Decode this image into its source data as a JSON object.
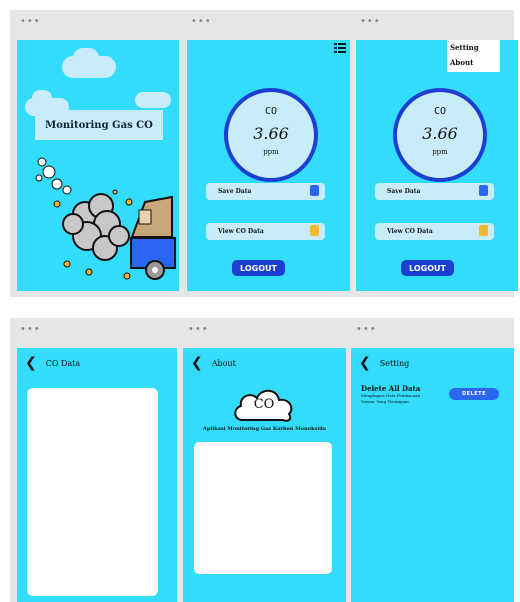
{
  "screens": {
    "splash": {
      "title": "Monitoring Gas CO"
    },
    "home": {
      "gas_label": "CO",
      "reading": "3.66",
      "unit": "ppm",
      "save_label": "Save Data",
      "view_label": "View CO Data",
      "logout_label": "LOGOUT"
    },
    "home_menu": {
      "gas_label": "CO",
      "reading": "3.66",
      "unit": "ppm",
      "save_label": "Save Data",
      "view_label": "View CO Data",
      "logout_label": "LOGOUT",
      "menu_items": [
        "Setting",
        "About"
      ]
    },
    "co_data": {
      "title": "CO Data"
    },
    "about": {
      "title": "About",
      "logo_text": "CO",
      "app_name": "Aplikasi Monitoring Gas Karbon Monoksida"
    },
    "setting": {
      "title": "Setting",
      "delete_heading": "Delete All Data",
      "delete_desc_line1": "Menghapus Data Pembacaan",
      "delete_desc_line2": "Sensor Yang Tersimpan",
      "delete_button": "DELETE"
    }
  },
  "colors": {
    "screen_bg": "#33dcfb",
    "card_bg": "#c9ecfb",
    "accent": "#1b3fd0",
    "board_bg": "#e6e6e6"
  },
  "icons": {
    "back": "chevron-left-icon",
    "menu": "list-menu-icon",
    "save": "save-icon",
    "view": "document-icon"
  }
}
